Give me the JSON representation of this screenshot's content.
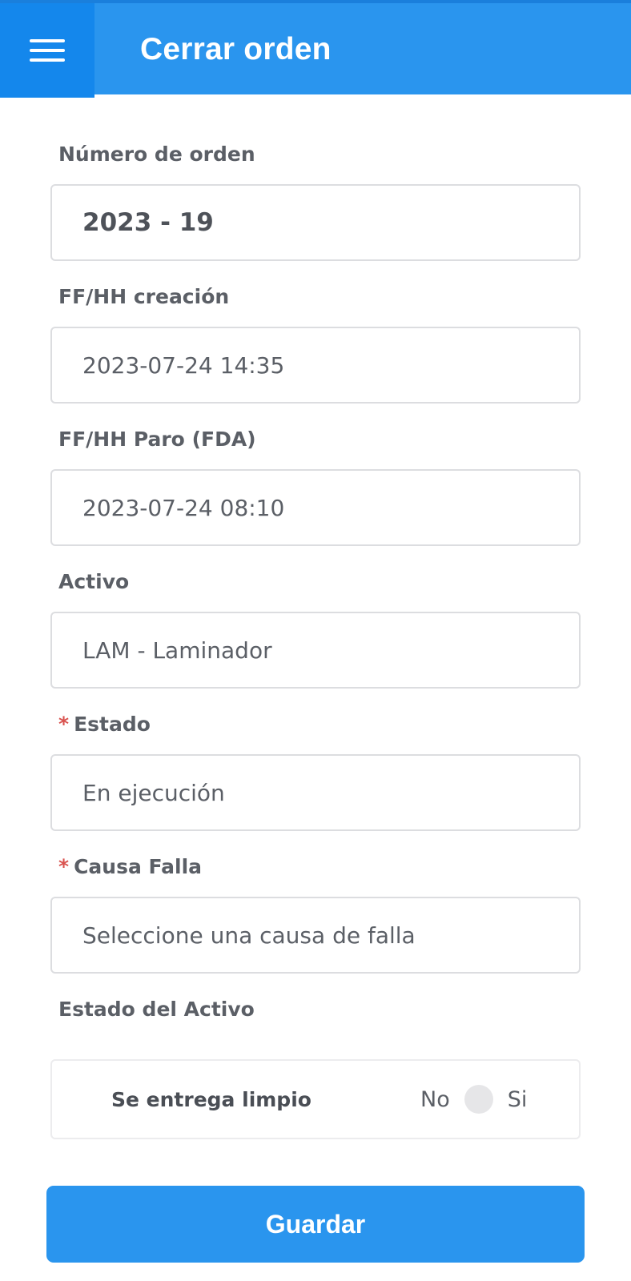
{
  "header": {
    "title": "Cerrar orden",
    "menu_icon": "hamburger-menu-icon"
  },
  "form": {
    "order_number": {
      "label": "Número de orden",
      "value": "2023 - 19"
    },
    "created_at": {
      "label": "FF/HH creación",
      "value": "2023-07-24 14:35"
    },
    "stop_at": {
      "label": "FF/HH Paro (FDA)",
      "value": "2023-07-24 08:10"
    },
    "asset": {
      "label": "Activo",
      "value": "LAM - Laminador"
    },
    "status": {
      "required_mark": "*",
      "label": "Estado",
      "value": "En ejecución"
    },
    "failure_cause": {
      "required_mark": "*",
      "label": "Causa Falla",
      "placeholder": "Seleccione una causa de falla"
    },
    "asset_status": {
      "label": "Estado del Activo",
      "clean_delivery": {
        "label": "Se entrega limpio",
        "off_label": "No",
        "on_label": "Si",
        "checked": false
      }
    }
  },
  "actions": {
    "save_label": "Guardar"
  },
  "colors": {
    "primary": "#2a95ee",
    "menu_bg": "#1487ec",
    "required": "#d9534f"
  }
}
